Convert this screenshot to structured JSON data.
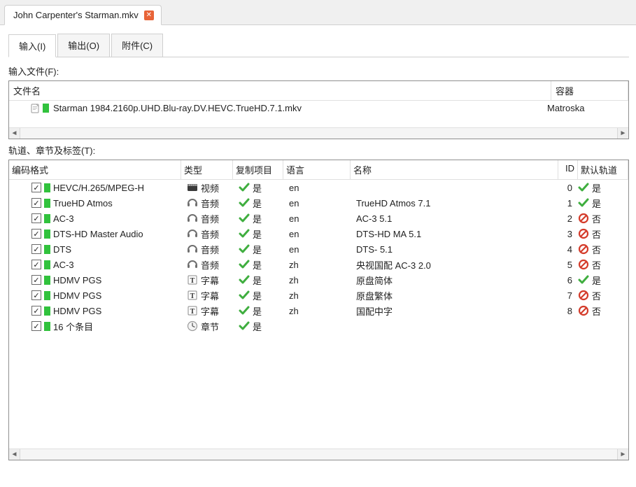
{
  "file_tab": {
    "title": "John Carpenter's Starman.mkv"
  },
  "page_tabs": {
    "input": "输入(I)",
    "output": "输出(O)",
    "attachments": "附件(C)"
  },
  "labels": {
    "input_file": "输入文件(F):",
    "tracks": "轨道、章节及标签(T):"
  },
  "file_header": {
    "name": "文件名",
    "container": "容器"
  },
  "file_row": {
    "name": "Starman 1984.2160p.UHD.Blu-ray.DV.HEVC.TrueHD.7.1.mkv",
    "container": "Matroska"
  },
  "track_header": {
    "codec": "编码格式",
    "type": "类型",
    "copy": "复制项目",
    "lang": "语言",
    "name": "名称",
    "id": "ID",
    "def": "默认轨道"
  },
  "type_labels": {
    "video": "视频",
    "audio": "音频",
    "subtitle": "字幕",
    "chapter": "章节"
  },
  "yesno": {
    "yes": "是",
    "no": "否"
  },
  "tracks": [
    {
      "codec": "HEVC/H.265/MPEG-H",
      "type": "video",
      "copy": true,
      "lang": "en",
      "name": "",
      "id": 0,
      "default": "yes"
    },
    {
      "codec": "TrueHD Atmos",
      "type": "audio",
      "copy": true,
      "lang": "en",
      "name": "TrueHD Atmos 7.1",
      "id": 1,
      "default": "yes"
    },
    {
      "codec": "AC-3",
      "type": "audio",
      "copy": true,
      "lang": "en",
      "name": "AC-3 5.1",
      "id": 2,
      "default": "no"
    },
    {
      "codec": "DTS-HD Master Audio",
      "type": "audio",
      "copy": true,
      "lang": "en",
      "name": "DTS-HD MA 5.1",
      "id": 3,
      "default": "no"
    },
    {
      "codec": "DTS",
      "type": "audio",
      "copy": true,
      "lang": "en",
      "name": "DTS- 5.1",
      "id": 4,
      "default": "no"
    },
    {
      "codec": "AC-3",
      "type": "audio",
      "copy": true,
      "lang": "zh",
      "name": "央视国配 AC-3 2.0",
      "id": 5,
      "default": "no"
    },
    {
      "codec": "HDMV PGS",
      "type": "subtitle",
      "copy": true,
      "lang": "zh",
      "name": "原盘简体",
      "id": 6,
      "default": "yes"
    },
    {
      "codec": "HDMV PGS",
      "type": "subtitle",
      "copy": true,
      "lang": "zh",
      "name": "原盘繁体",
      "id": 7,
      "default": "no"
    },
    {
      "codec": "HDMV PGS",
      "type": "subtitle",
      "copy": true,
      "lang": "zh",
      "name": "国配中字",
      "id": 8,
      "default": "no"
    },
    {
      "codec": "16 个条目",
      "type": "chapter",
      "copy": true,
      "lang": "",
      "name": "",
      "id": "",
      "default": ""
    }
  ]
}
